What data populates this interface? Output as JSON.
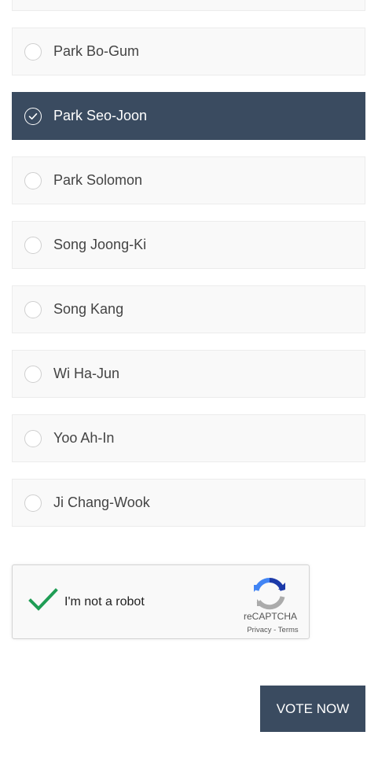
{
  "poll": {
    "options": [
      {
        "label": "Park Bo-Gum",
        "selected": false
      },
      {
        "label": "Park Seo-Joon",
        "selected": true
      },
      {
        "label": "Park Solomon",
        "selected": false
      },
      {
        "label": "Song Joong-Ki",
        "selected": false
      },
      {
        "label": "Song Kang",
        "selected": false
      },
      {
        "label": "Wi Ha-Jun",
        "selected": false
      },
      {
        "label": "Yoo Ah-In",
        "selected": false
      },
      {
        "label": "Ji Chang-Wook",
        "selected": false
      }
    ]
  },
  "recaptcha": {
    "label": "I'm not a robot",
    "checked": true,
    "brand": "reCAPTCHA",
    "privacy": "Privacy",
    "separator": " - ",
    "terms": "Terms"
  },
  "vote_button": {
    "label": "VOTE NOW"
  },
  "colors": {
    "accent": "#3a4b60",
    "check": "#1f9d55"
  }
}
